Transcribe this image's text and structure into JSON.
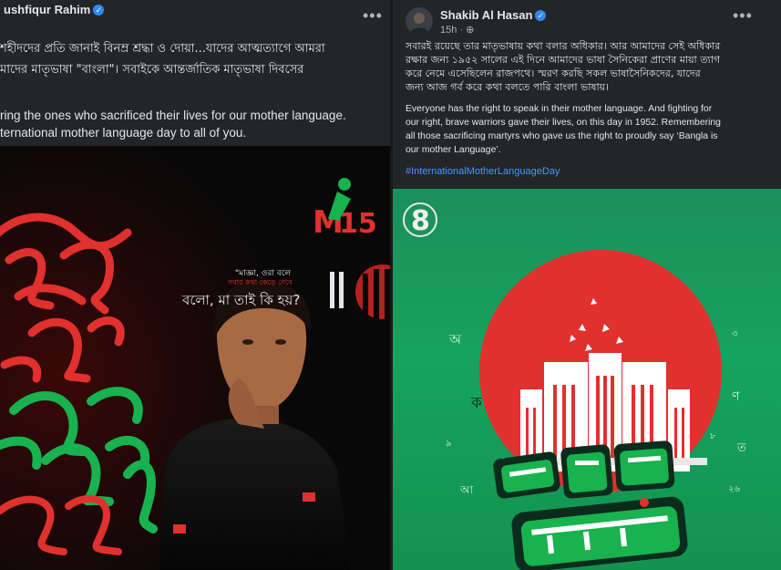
{
  "left_post": {
    "author": "ushfiqur Rahim",
    "bangla_lines": [
      "শহীদদের প্রতি জানাই বিনম্র শ্রদ্ধা ও দোয়া...যাদের আত্মত্যাগে আমরা",
      "মাদের মাতৃভাষা \"বাংলা\"। সবাইকে আন্তর্জাতিক মাতৃভাষা দিবসের"
    ],
    "english_lines": [
      "ring the ones who sacrificed their lives for our mother language.",
      "ternational mother language day to all of you."
    ],
    "media": {
      "brand_mark": "15",
      "quote_lines": [
        "\"মাজ্ঞা, ওরা বলে",
        "সবার কথা কেড়ে নেবে",
        "বলো, মা তাই কি হয়?"
      ]
    }
  },
  "right_post": {
    "author": "Shakib Al Hasan",
    "time": "15h",
    "bangla_lines": [
      "সবারই রয়েছে তার মাতৃভাষায় কথা বলার অধিকার। আর আমাদের সেই অধিকার",
      "রক্ষার জন্য ১৯৫২ সালের এই দিনে আমাদের ভাষা সৈনিকেরা প্রাণের মায়া ত্যাগ",
      "করে নেমে এসেছিলেন রাজপথে। স্মরণ করছি সকল ভাষাসৈনিকদের, যাদের",
      "জন্য আজ গর্ব করে কথা বলতে পারি বাংলা ভাষায়।"
    ],
    "english_lines": [
      "Everyone has the right to speak in their mother language. And fighting for",
      "our right, brave warriors gave their lives, on this day in 1952. Remembering",
      "all those sacrificing martyrs who gave us the right to proudly say ‘Bangla is",
      "our mother Language’."
    ],
    "hashtag": "#InternationalMotherLanguageDay",
    "media": {
      "logo_mark": "8",
      "floating_letters": [
        "অ",
        "ক",
        "ণ",
        "ত",
        "আ",
        "৯",
        "৮",
        "২৬",
        "৩"
      ]
    }
  },
  "colors": {
    "background": "#18191a",
    "card": "#242526",
    "text": "#e4e6eb",
    "secondary_text": "#b0b3b8",
    "link": "#4599ff",
    "verified": "#2d88ff",
    "poster_red": "#e0312f",
    "poster_green": "#18b24f"
  },
  "icons": {
    "verified": "verified-badge-icon",
    "more": "more-options-icon",
    "audience": "globe-icon"
  }
}
